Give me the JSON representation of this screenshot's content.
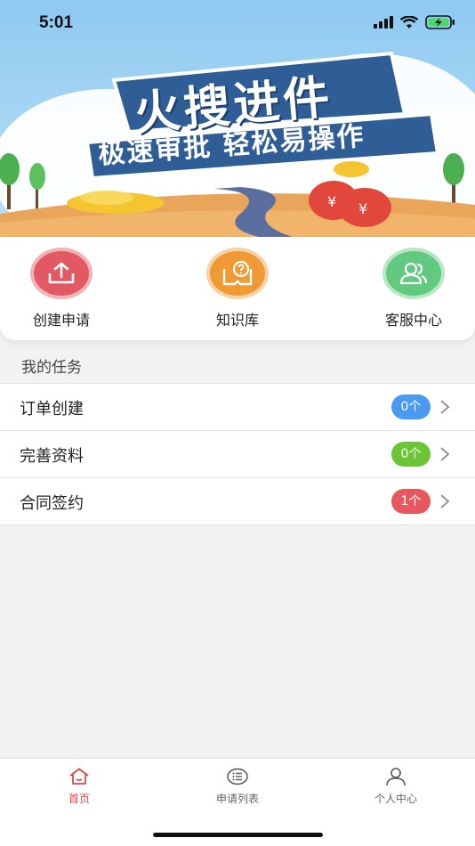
{
  "status_bar": {
    "time": "5:01"
  },
  "banner": {
    "headline": "火搜进件",
    "tagline": "极速审批 轻松易操作"
  },
  "quick_actions": [
    {
      "label": "创建申请",
      "icon": "upload-icon",
      "color": "#e25863"
    },
    {
      "label": "知识库",
      "icon": "help-book-icon",
      "color": "#ef9a35"
    },
    {
      "label": "客服中心",
      "icon": "users-icon",
      "color": "#62c980"
    }
  ],
  "tasks": {
    "title": "我的任务",
    "items": [
      {
        "label": "订单创建",
        "badge": "0个",
        "badge_color": "#4a9af1"
      },
      {
        "label": "完善资料",
        "badge": "0个",
        "badge_color": "#6cc437"
      },
      {
        "label": "合同签约",
        "badge": "1个",
        "badge_color": "#e6585e"
      }
    ]
  },
  "tab_bar": {
    "tabs": [
      {
        "label": "首页",
        "icon": "home-icon",
        "active": true
      },
      {
        "label": "申请列表",
        "icon": "list-icon",
        "active": false
      },
      {
        "label": "个人中心",
        "icon": "person-icon",
        "active": false
      }
    ],
    "active_color": "#e0474c"
  }
}
